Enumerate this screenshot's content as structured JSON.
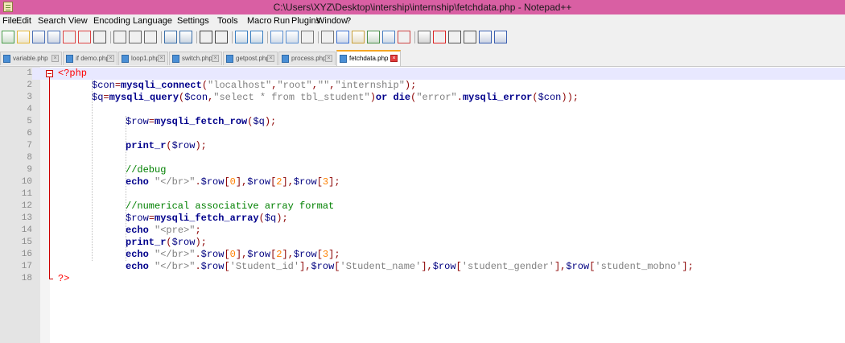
{
  "window": {
    "title": "C:\\Users\\XYZ\\Desktop\\intership\\internship\\fetchdata.php - Notepad++",
    "accent": "#d95fa3"
  },
  "menu": [
    "File",
    "Edit",
    "Search",
    "View",
    "Encoding",
    "Language",
    "Settings",
    "Tools",
    "Macro",
    "Run",
    "Plugins",
    "Window",
    "?"
  ],
  "toolbar": {
    "icons": [
      "new-file-icon",
      "open-icon",
      "save-icon",
      "save-all-icon",
      "close-icon",
      "close-all-icon",
      "print-icon",
      "cut-icon",
      "copy-icon",
      "paste-icon",
      "undo-icon",
      "redo-icon",
      "find-icon",
      "replace-icon",
      "zoom-in-icon",
      "zoom-out-icon",
      "sync-vertical-icon",
      "sync-horizontal-icon",
      "word-wrap-icon",
      "show-all-chars-icon",
      "indent-guide-icon",
      "user-language-icon",
      "document-map-icon",
      "function-list-icon",
      "folder-workspace-icon",
      "monitoring-icon",
      "record-macro-icon",
      "stop-record-icon",
      "play-macro-icon",
      "run-macro-multiple-icon",
      "save-macro-icon"
    ]
  },
  "tabs": [
    {
      "label": "variable.php",
      "active": false
    },
    {
      "label": "if demo.php",
      "active": false
    },
    {
      "label": "loop1.php",
      "active": false
    },
    {
      "label": "switch.php",
      "active": false
    },
    {
      "label": "getpost.php",
      "active": false
    },
    {
      "label": "process.php",
      "active": false
    },
    {
      "label": "fetchdata.php",
      "active": true
    }
  ],
  "editor": {
    "current_line": 1,
    "line_numbers": [
      "1",
      "2",
      "3",
      "4",
      "5",
      "6",
      "7",
      "8",
      "9",
      "10",
      "11",
      "12",
      "13",
      "14",
      "15",
      "16",
      "17",
      "18"
    ],
    "lines": [
      "<?php",
      "\t$con=mysqli_connect(\"localhost\",\"root\",\"\",\"internship\");",
      "\t$q=mysqli_query($con,\"select * from tbl_student\")or die(\"error\".mysqli_error($con));",
      "",
      "\t\t$row=mysqli_fetch_row($q);",
      "",
      "\t\tprint_r($row);",
      "",
      "\t\t//debug",
      "\t\techo \"</br>\".$row[0],$row[2],$row[3];",
      "",
      "\t\t//numerical associative array format",
      "\t\t$row=mysqli_fetch_array($q);",
      "\t\techo \"<pre>\";",
      "\t\tprint_r($row);",
      "\t\techo \"</br>\".$row[0],$row[2],$row[3];",
      "\t\techo \"</br>\".$row['Student_id'],$row['Student_name'],$row['student_gender'],$row['student_mobno'];",
      "?>"
    ]
  }
}
